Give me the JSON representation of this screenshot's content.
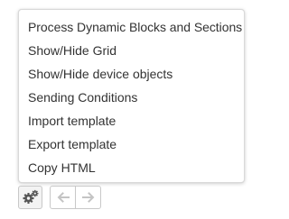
{
  "menu": {
    "items": [
      {
        "label": "Process Dynamic Blocks and Sections"
      },
      {
        "label": "Show/Hide Grid"
      },
      {
        "label": "Show/Hide device objects"
      },
      {
        "label": "Sending Conditions"
      },
      {
        "label": "Import template"
      },
      {
        "label": "Export template"
      },
      {
        "label": "Copy HTML"
      }
    ]
  },
  "toolbar": {
    "settings_icon": "gears-icon",
    "undo_icon": "arrow-left-icon",
    "redo_icon": "arrow-right-icon",
    "undo_enabled": false,
    "redo_enabled": false
  },
  "colors": {
    "menu_text": "#333333",
    "menu_border": "#d9d9d9",
    "icon_active": "#555555",
    "icon_disabled": "#c4c4c4"
  }
}
